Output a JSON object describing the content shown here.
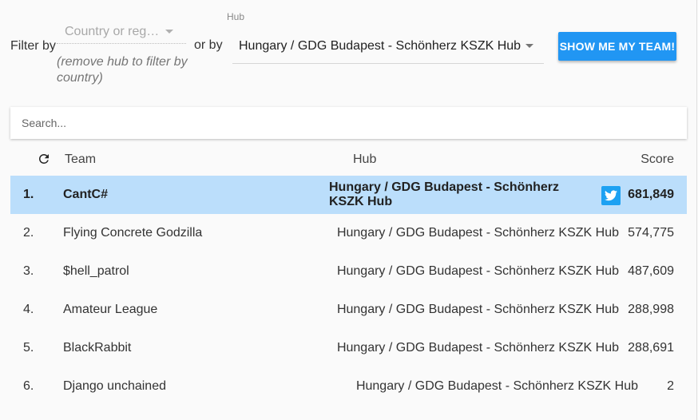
{
  "filter": {
    "label": "Filter by",
    "country_placeholder": "Country or reg…",
    "remove_hint": "(remove hub to filter by country)",
    "or_by": "or by",
    "hub_caption": "Hub",
    "hub_value": "Hungary / GDG Budapest - Schönherz KSZK Hub",
    "button_label": "Show me my team!"
  },
  "search": {
    "placeholder": "Search..."
  },
  "table": {
    "refresh_icon": "refresh-icon",
    "headers": {
      "team": "Team",
      "hub": "Hub",
      "score": "Score"
    },
    "rows": [
      {
        "rank": "1.",
        "team": "CantC#",
        "hub": "Hungary / GDG Budapest - Schönherz KSZK Hub",
        "score": "681,849",
        "highlighted": true,
        "twitter_icon": "twitter-icon"
      },
      {
        "rank": "2.",
        "team": "Flying Concrete Godzilla",
        "hub": "Hungary / GDG Budapest - Schönherz KSZK Hub",
        "score": "574,775"
      },
      {
        "rank": "3.",
        "team": "$hell_patrol",
        "hub": "Hungary / GDG Budapest - Schönherz KSZK Hub",
        "score": "487,609"
      },
      {
        "rank": "4.",
        "team": "Amateur League",
        "hub": "Hungary / GDG Budapest - Schönherz KSZK Hub",
        "score": "288,998"
      },
      {
        "rank": "5.",
        "team": "BlackRabbit",
        "hub": "Hungary / GDG Budapest - Schönherz KSZK Hub",
        "score": "288,691"
      },
      {
        "rank": "6.",
        "team": "Django unchained",
        "hub": "Hungary / GDG Budapest - Schönherz KSZK Hub",
        "score": "2"
      }
    ]
  },
  "colors": {
    "accent": "#2196f3",
    "highlight_row": "#bbdefb",
    "twitter": "#1da1f2"
  }
}
